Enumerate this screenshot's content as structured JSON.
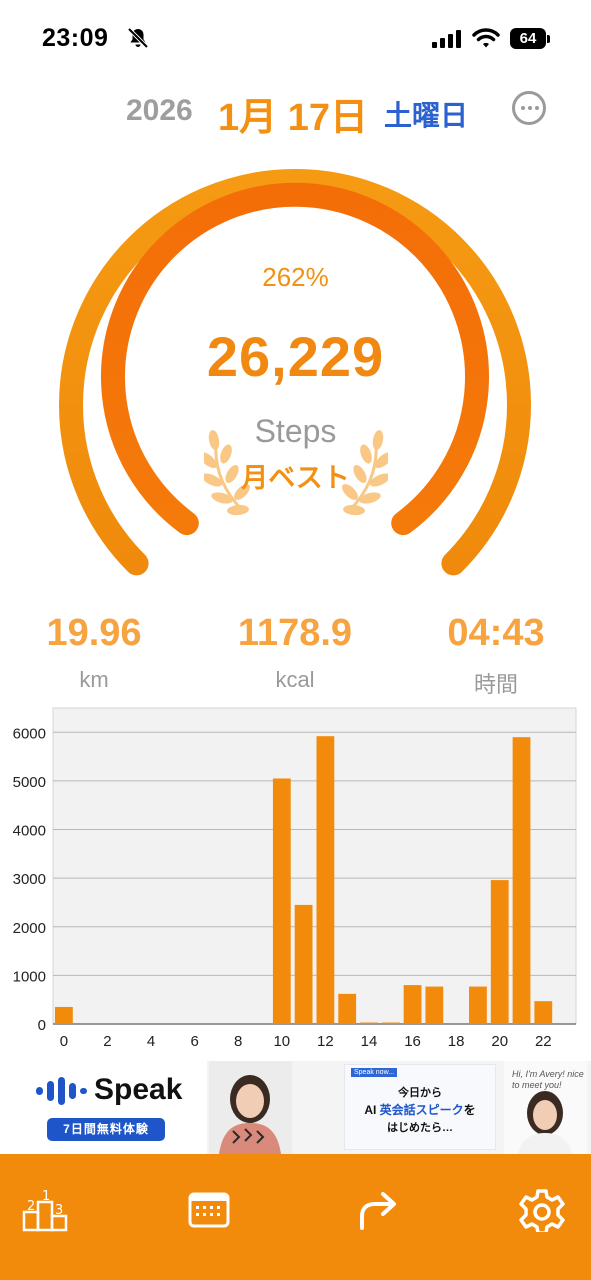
{
  "status_bar": {
    "time": "23:09",
    "battery": "64"
  },
  "header": {
    "year": "2026",
    "month_day": "1月 17日",
    "weekday": "土曜日"
  },
  "summary": {
    "percent": "262%",
    "steps": "26,229",
    "steps_label": "Steps",
    "badge": "月ベスト",
    "goal_progress": 2.62
  },
  "stats": [
    {
      "value": "19.96",
      "unit": "km"
    },
    {
      "value": "1178.9",
      "unit": "kcal"
    },
    {
      "value": "04:43",
      "unit": "時間"
    }
  ],
  "chart_data": {
    "type": "bar",
    "x": [
      0,
      1,
      2,
      3,
      4,
      5,
      6,
      7,
      8,
      9,
      10,
      11,
      12,
      13,
      14,
      15,
      16,
      17,
      18,
      19,
      20,
      21,
      22,
      23
    ],
    "values": [
      350,
      0,
      0,
      0,
      0,
      0,
      0,
      0,
      0,
      0,
      5050,
      2450,
      5920,
      620,
      30,
      30,
      800,
      770,
      0,
      770,
      2960,
      5900,
      470,
      0
    ],
    "x_ticks": [
      "0",
      "2",
      "4",
      "6",
      "8",
      "10",
      "12",
      "14",
      "16",
      "18",
      "20",
      "22"
    ],
    "y_ticks": [
      "0",
      "1000",
      "2000",
      "3000",
      "4000",
      "5000",
      "6000"
    ],
    "ylim": [
      0,
      6500
    ],
    "bar_color": "#f28a0c",
    "grid": true
  },
  "ad": {
    "brand": "Speak",
    "cta": "7日間無料体験",
    "mid_tag": "Speak now...",
    "mid_line1": "今日から",
    "mid_line2a": "AI ",
    "mid_line2b": "英会話スピーク",
    "mid_line2c": "を",
    "mid_line3": "はじめたら…",
    "hello": "Hi, I'm Avery! nice to meet you!"
  },
  "colors": {
    "accent": "#f28a0c",
    "accent_light": "#f6a340",
    "accent_dark": "#f26d0a",
    "weekday": "#2c62d0"
  },
  "tabs": [
    {
      "icon": "podium-icon"
    },
    {
      "icon": "calendar-icon"
    },
    {
      "icon": "share-arrow-icon"
    },
    {
      "icon": "gear-icon"
    }
  ]
}
